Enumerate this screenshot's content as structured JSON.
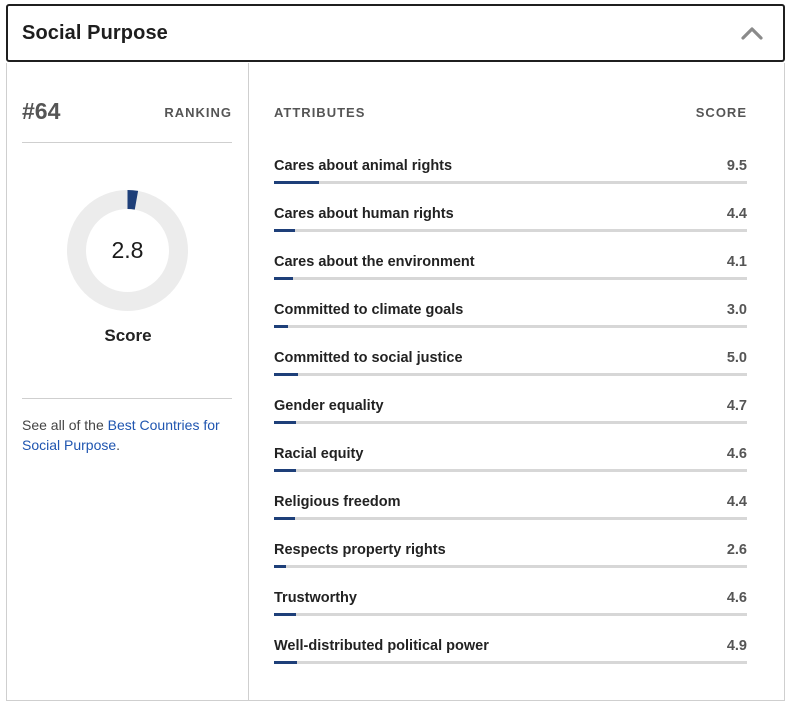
{
  "header": {
    "title": "Social Purpose",
    "toggle_icon": "chevron-up-icon"
  },
  "ranking": {
    "number": "#64",
    "label": "RANKING"
  },
  "score": {
    "value": "2.8",
    "label": "Score",
    "fraction_of_10": 0.028,
    "fill_color": "#1e3f79",
    "track_color": "#ececec"
  },
  "see_all": {
    "prefix": "See all of the ",
    "link_text": "Best Countries for Social Purpose",
    "suffix": "."
  },
  "table": {
    "attributes_header": "ATTRIBUTES",
    "score_header": "SCORE",
    "bar_color": "#1e3f79",
    "track_color": "#d7d7d7",
    "rows": [
      {
        "label": "Cares about animal rights",
        "score": "9.5",
        "bar_fraction": 0.095
      },
      {
        "label": "Cares about human rights",
        "score": "4.4",
        "bar_fraction": 0.044
      },
      {
        "label": "Cares about the environment",
        "score": "4.1",
        "bar_fraction": 0.041
      },
      {
        "label": "Committed to climate goals",
        "score": "3.0",
        "bar_fraction": 0.03
      },
      {
        "label": "Committed to social justice",
        "score": "5.0",
        "bar_fraction": 0.05
      },
      {
        "label": "Gender equality",
        "score": "4.7",
        "bar_fraction": 0.047
      },
      {
        "label": "Racial equity",
        "score": "4.6",
        "bar_fraction": 0.046
      },
      {
        "label": "Religious freedom",
        "score": "4.4",
        "bar_fraction": 0.044
      },
      {
        "label": "Respects property rights",
        "score": "2.6",
        "bar_fraction": 0.026
      },
      {
        "label": "Trustworthy",
        "score": "4.6",
        "bar_fraction": 0.046
      },
      {
        "label": "Well-distributed political power",
        "score": "4.9",
        "bar_fraction": 0.049
      }
    ]
  }
}
